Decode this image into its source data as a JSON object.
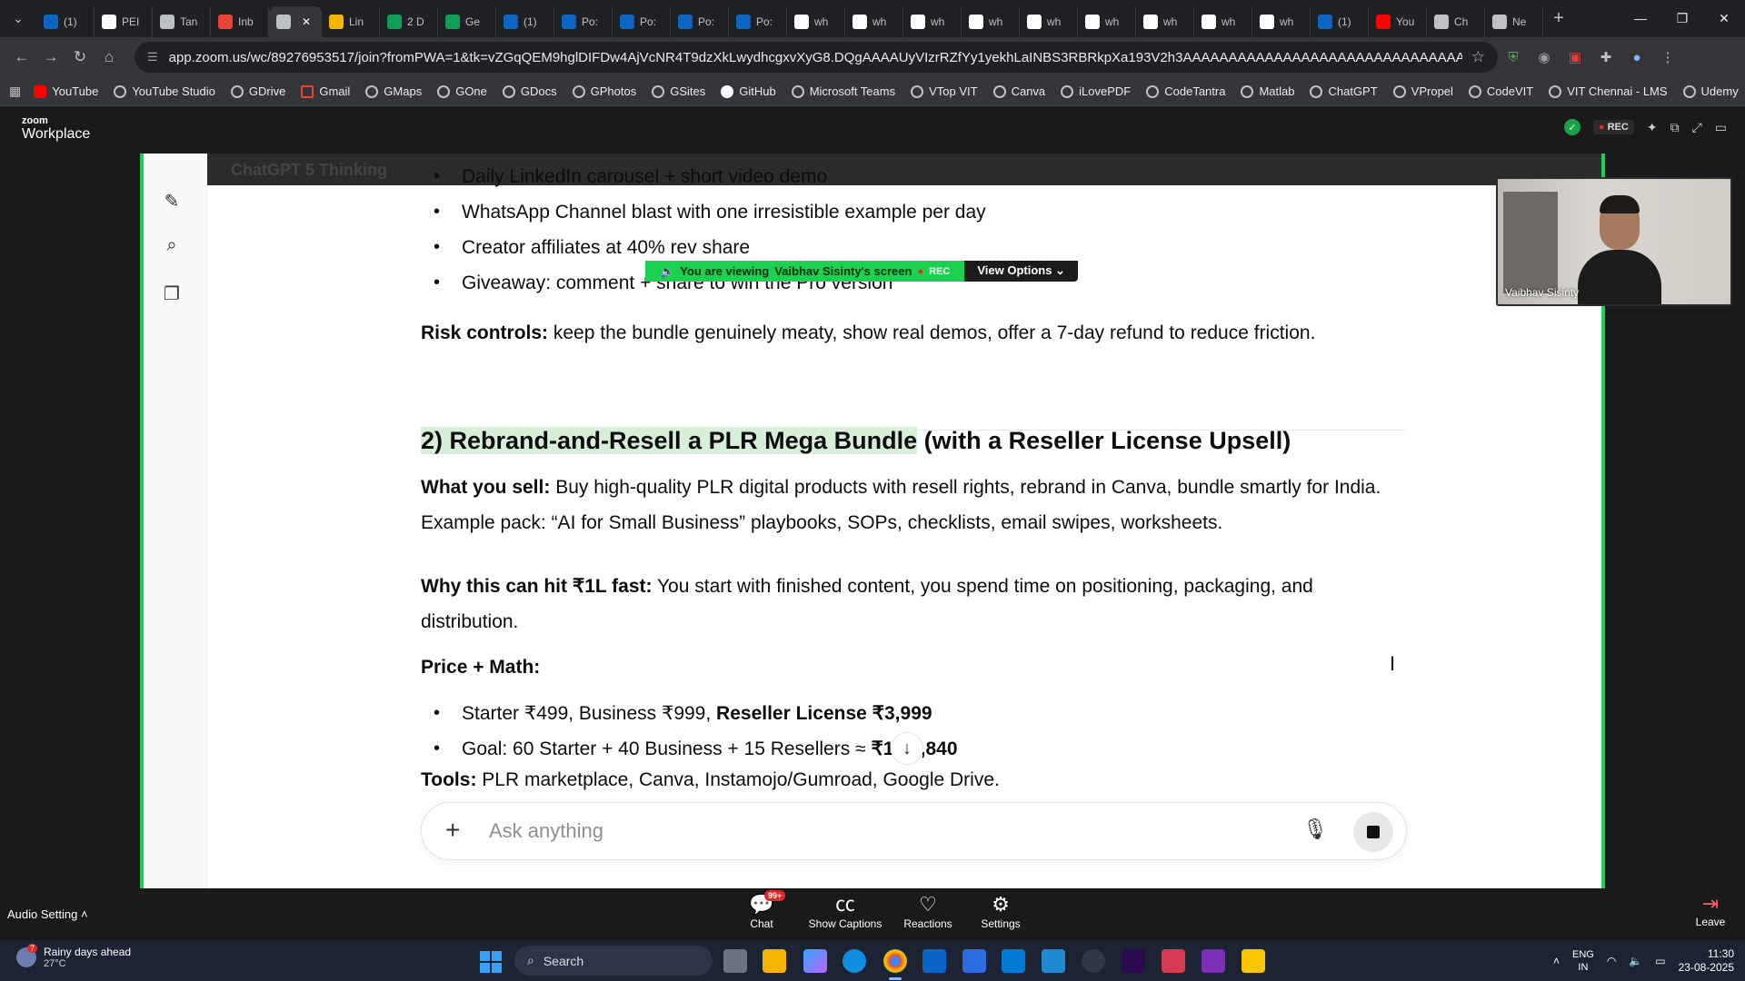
{
  "browser": {
    "tabs": [
      {
        "label": "(1)",
        "icon": "linkedin-icon",
        "color": "#0a66c2"
      },
      {
        "label": "PEI",
        "icon": "github-icon",
        "color": "#ffffff"
      },
      {
        "label": "Tan",
        "icon": "chatgpt-icon",
        "color": "#bdc1c6"
      },
      {
        "label": "Inb",
        "icon": "gmail-icon",
        "color": "#ea4335"
      },
      {
        "label": "",
        "icon": "audio-icon",
        "color": "#bdc1c6",
        "active": true
      },
      {
        "label": "Lin",
        "icon": "linear-icon",
        "color": "#f4b400"
      },
      {
        "label": "2 D",
        "icon": "sheets-icon",
        "color": "#0f9d58"
      },
      {
        "label": "Ge",
        "icon": "sheets-icon",
        "color": "#0f9d58"
      },
      {
        "label": "(1)",
        "icon": "linkedin-icon",
        "color": "#0a66c2"
      },
      {
        "label": "Po:",
        "icon": "linkedin-icon",
        "color": "#0a66c2"
      },
      {
        "label": "Po:",
        "icon": "linkedin-icon",
        "color": "#0a66c2"
      },
      {
        "label": "Po:",
        "icon": "linkedin-icon",
        "color": "#0a66c2"
      },
      {
        "label": "Po:",
        "icon": "linkedin-icon",
        "color": "#0a66c2"
      },
      {
        "label": "wh",
        "icon": "google-icon",
        "color": "#ffffff"
      },
      {
        "label": "wh",
        "icon": "google-icon",
        "color": "#ffffff"
      },
      {
        "label": "wh",
        "icon": "google-icon",
        "color": "#ffffff"
      },
      {
        "label": "wh",
        "icon": "google-icon",
        "color": "#ffffff"
      },
      {
        "label": "wh",
        "icon": "google-icon",
        "color": "#ffffff"
      },
      {
        "label": "wh",
        "icon": "google-icon",
        "color": "#ffffff"
      },
      {
        "label": "wh",
        "icon": "google-icon",
        "color": "#ffffff"
      },
      {
        "label": "wh",
        "icon": "google-icon",
        "color": "#ffffff"
      },
      {
        "label": "wh",
        "icon": "google-icon",
        "color": "#ffffff"
      },
      {
        "label": "(1)",
        "icon": "linkedin-icon",
        "color": "#0a66c2"
      },
      {
        "label": "You",
        "icon": "youtube-icon",
        "color": "#ff0000"
      },
      {
        "label": "Ch",
        "icon": "chatgpt-icon",
        "color": "#bdc1c6"
      },
      {
        "label": "Ne",
        "icon": "chatgpt-icon",
        "color": "#bdc1c6"
      }
    ],
    "new_tab": "+",
    "url": "app.zoom.us/wc/89276953517/join?fromPWA=1&tk=vZGqQEM9hglDIFDw4AjVcNR4T9dzXkLwydhcgxvXyG8.DQgAAAAUyVIzrRZfYy1yekhLaINBS3RBRkpXa193V2h3AAAAAAAAAAAAAAAAAAAAAAAAAAAAAAAAAAAAAA&_x_zm_r...",
    "bookmarks": [
      {
        "label": "YouTube",
        "icon": "youtube-icon"
      },
      {
        "label": "YouTube Studio",
        "icon": "globe-icon"
      },
      {
        "label": "GDrive",
        "icon": "globe-icon"
      },
      {
        "label": "Gmail",
        "icon": "gmail-icon"
      },
      {
        "label": "GMaps",
        "icon": "globe-icon"
      },
      {
        "label": "GOne",
        "icon": "globe-icon"
      },
      {
        "label": "GDocs",
        "icon": "globe-icon"
      },
      {
        "label": "GPhotos",
        "icon": "globe-icon"
      },
      {
        "label": "GSites",
        "icon": "globe-icon"
      },
      {
        "label": "GitHub",
        "icon": "github-icon"
      },
      {
        "label": "Microsoft Teams",
        "icon": "globe-icon"
      },
      {
        "label": "VTop VIT",
        "icon": "globe-icon"
      },
      {
        "label": "Canva",
        "icon": "globe-icon"
      },
      {
        "label": "iLovePDF",
        "icon": "globe-icon"
      },
      {
        "label": "CodeTantra",
        "icon": "globe-icon"
      },
      {
        "label": "Matlab",
        "icon": "globe-icon"
      },
      {
        "label": "ChatGPT",
        "icon": "chatgpt-icon"
      },
      {
        "label": "VPropel",
        "icon": "globe-icon"
      },
      {
        "label": "CodeVIT",
        "icon": "globe-icon"
      },
      {
        "label": "VIT Chennai - LMS",
        "icon": "globe-icon"
      },
      {
        "label": "Udemy",
        "icon": "globe-icon"
      }
    ]
  },
  "zoom": {
    "logo_top": "zoom",
    "logo_bottom": "Workplace",
    "rec": "REC",
    "banner": {
      "viewing_prefix": "You are viewing",
      "viewing_name": "Vaibhav Sisinty's screen",
      "rec": "REC",
      "view_options": "View Options"
    },
    "participant_name": "Vaibhav Sisinty",
    "audio_setting": "Audio Setting",
    "controls": {
      "chat": "Chat",
      "chat_badge": "99+",
      "captions": "Show Captions",
      "reactions": "Reactions",
      "settings": "Settings",
      "leave": "Leave"
    }
  },
  "shared_doc": {
    "faded_header": "ChatGPT 5 Thinking",
    "bullets_top": [
      "Daily LinkedIn carousel + short video demo",
      "WhatsApp Channel blast with one irresistible example per day",
      "Creator affiliates at 40% rev share",
      "Giveaway: comment + share to win the Pro version"
    ],
    "risk_label": "Risk controls:",
    "risk_text": " keep the bundle genuinely meaty, show real demos, offer a 7-day refund to reduce friction.",
    "heading_highlight": "2) Rebrand-and-Resell a PLR Mega Bundle",
    "heading_rest": " (with a Reseller License Upsell)",
    "sell_label": "What you sell:",
    "sell_text": " Buy high-quality PLR digital products with resell rights, rebrand in Canva, bundle smartly for India. Example pack: “AI for Small Business” playbooks, SOPs, checklists, email swipes, worksheets.",
    "why_label": "Why this can hit ₹1L fast:",
    "why_text": " You start with finished content, you spend time on positioning, packaging, and distribution.",
    "price_label": "Price + Math:",
    "price_bullet1_text": "Starter ₹499, Business ₹999, ",
    "price_bullet1_bold": "Reseller License ₹3,999",
    "price_bullet2_text": "Goal: 60 Starter + 40 Business + 15 Resellers ≈ ",
    "price_bullet2_bold": "₹1,02,840",
    "tools_label": "Tools:",
    "tools_text": " PLR marketplace, Canva, Instamojo/Gumroad, Google Drive.",
    "ask_placeholder": "Ask anything"
  },
  "taskbar": {
    "weather_title": "Rainy days ahead",
    "weather_temp": "27°C",
    "weather_badge": "7",
    "search": "Search",
    "lang_top": "ENG",
    "lang_bottom": "IN",
    "time": "11:30",
    "date": "23-08-2025"
  }
}
